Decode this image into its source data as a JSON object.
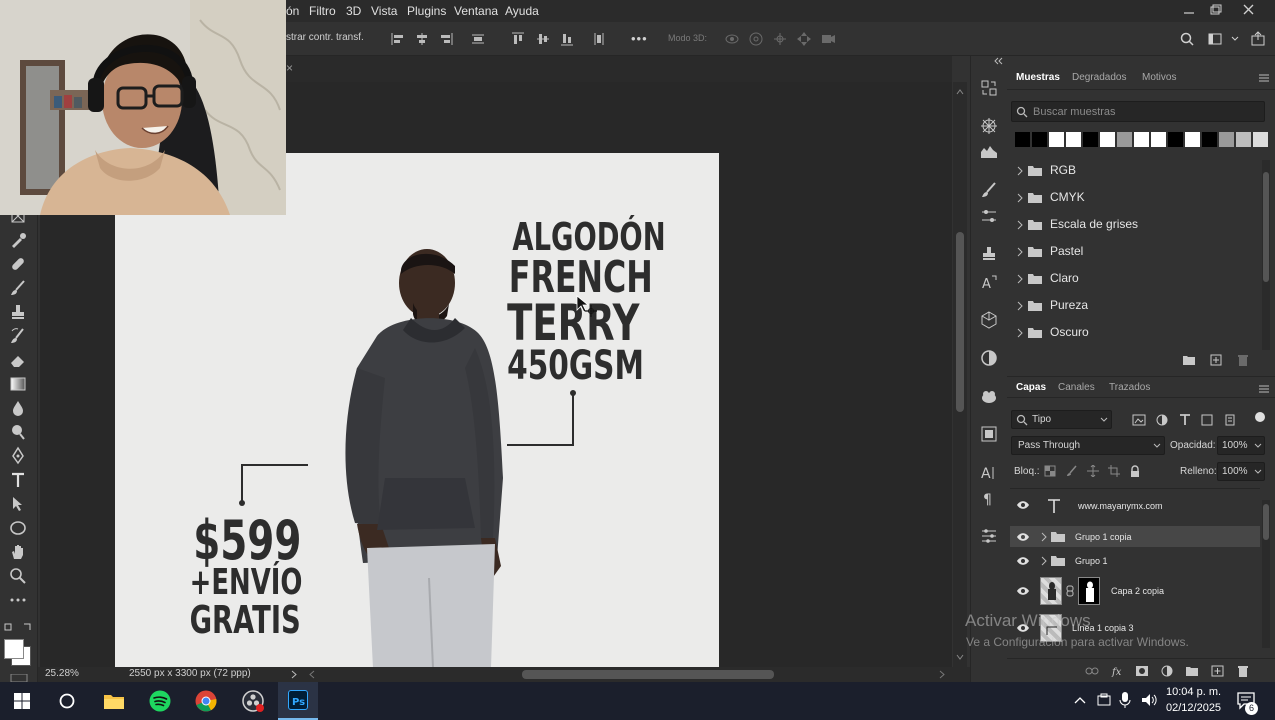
{
  "menu": {
    "items": [
      "ón",
      "Filtro",
      "3D",
      "Vista",
      "Plugins",
      "Ventana",
      "Ayuda"
    ]
  },
  "options_bar": {
    "transform_label": "strar contr. transf.",
    "mode3d_label": "Modo 3D:",
    "more_label": "•••"
  },
  "tab": {
    "close": "×"
  },
  "canvas_text": {
    "algodon": "ALGODÓN",
    "french": "FRENCH",
    "terry": "TERRY",
    "weight": "450GSM",
    "price": "$599",
    "envio": "+ENVÍO",
    "gratis": "GRATIS"
  },
  "status": {
    "zoom": "25.28%",
    "doc_info": "2550 px x 3300 px (72 ppp)"
  },
  "swatches_panel": {
    "tabs": [
      "Muestras",
      "Degradados",
      "Motivos"
    ],
    "search_placeholder": "Buscar muestras",
    "swatch_colors": [
      "#000000",
      "#000000",
      "#ffffff",
      "#ffffff",
      "#000000",
      "#ffffff",
      "#9a9a9a",
      "#ffffff",
      "#ffffff",
      "#000000",
      "#ffffff",
      "#000000",
      "#9a9a9a",
      "#bdbdbd",
      "#dcdcdc"
    ],
    "folders": [
      "RGB",
      "CMYK",
      "Escala de grises",
      "Pastel",
      "Claro",
      "Pureza",
      "Oscuro"
    ]
  },
  "layers_panel": {
    "tabs": [
      "Capas",
      "Canales",
      "Trazados"
    ],
    "filter_label": "Tipo",
    "blend_mode": "Pass Through",
    "opacity_label": "Opacidad:",
    "opacity_value": "100%",
    "lock_label": "Bloq.:",
    "fill_label": "Relleno:",
    "fill_value": "100%",
    "layers": [
      {
        "name": "www.mayanymx.com",
        "type": "text"
      },
      {
        "name": "Grupo 1 copia",
        "type": "group"
      },
      {
        "name": "Grupo 1",
        "type": "group"
      },
      {
        "name": "Capa 2 copia",
        "type": "pixel"
      },
      {
        "name": "Línea 1 copia 3",
        "type": "shape"
      }
    ]
  },
  "windows_watermark": {
    "title": "Activar Windows",
    "subtitle": "Ve a Configuración para activar Windows."
  },
  "taskbar": {
    "time": "10:04 p. m.",
    "date": "02/12/2025",
    "notifications": "6"
  },
  "colors": {
    "accent": "#1473e6",
    "panel_bg": "#323232",
    "canvas_bg": "#ebebea",
    "text_dark": "#2d2d2d"
  }
}
